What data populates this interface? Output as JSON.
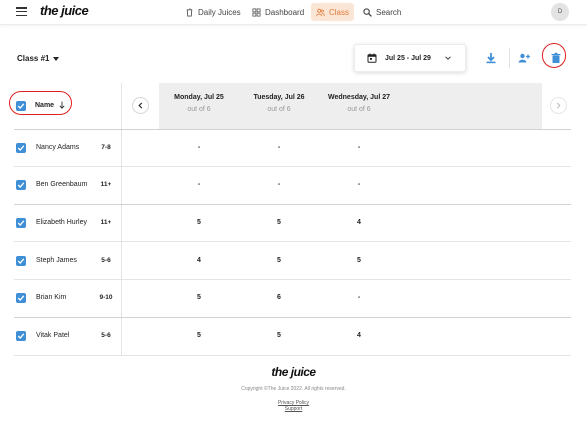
{
  "nav": {
    "logo": "the juice",
    "items": [
      {
        "label": "Daily Juices",
        "icon": "juice-cup-icon",
        "active": false
      },
      {
        "label": "Dashboard",
        "icon": "grid-icon",
        "active": false
      },
      {
        "label": "Class",
        "icon": "users-icon",
        "active": true
      },
      {
        "label": "Search",
        "icon": "search-icon",
        "active": false
      }
    ],
    "avatar": "D"
  },
  "toolbar": {
    "class_select": "Class #1",
    "date_range": "Jul 25 - Jul 29",
    "download_icon": "download-icon",
    "add_student_icon": "add-user-icon",
    "delete_icon": "trash-icon"
  },
  "table": {
    "name_header": "Name",
    "days": [
      {
        "label": "Monday, Jul 25",
        "sub": "out of 6"
      },
      {
        "label": "Tuesday, Jul 26",
        "sub": "out of 6"
      },
      {
        "label": "Wednesday, Jul 27",
        "sub": "out of 6"
      }
    ],
    "rows": [
      {
        "name": "Nancy Adams",
        "grade": "7-8",
        "scores": [
          "-",
          "-",
          "-"
        ]
      },
      {
        "name": "Ben Greenbaum",
        "grade": "11+",
        "scores": [
          "-",
          "-",
          "-"
        ]
      },
      {
        "name": "Elizabeth Hurley",
        "grade": "11+",
        "scores": [
          "5",
          "5",
          "4"
        ]
      },
      {
        "name": "Steph James",
        "grade": "5-6",
        "scores": [
          "4",
          "5",
          "5"
        ]
      },
      {
        "name": "Brian Kim",
        "grade": "9-10",
        "scores": [
          "5",
          "6",
          "-"
        ]
      },
      {
        "name": "Vitak Patel",
        "grade": "5-6",
        "scores": [
          "5",
          "5",
          "4"
        ]
      }
    ]
  },
  "footer": {
    "logo": "the juice",
    "copyright": "Copyright ©The Juice 2022. All rights reserved.",
    "privacy": "Privacy Policy",
    "support": "Support"
  },
  "colors": {
    "accent": "#e07b3a",
    "accent_bg": "#fbe6d6",
    "primary": "#3f8fd6",
    "annotation": "#e02020"
  }
}
